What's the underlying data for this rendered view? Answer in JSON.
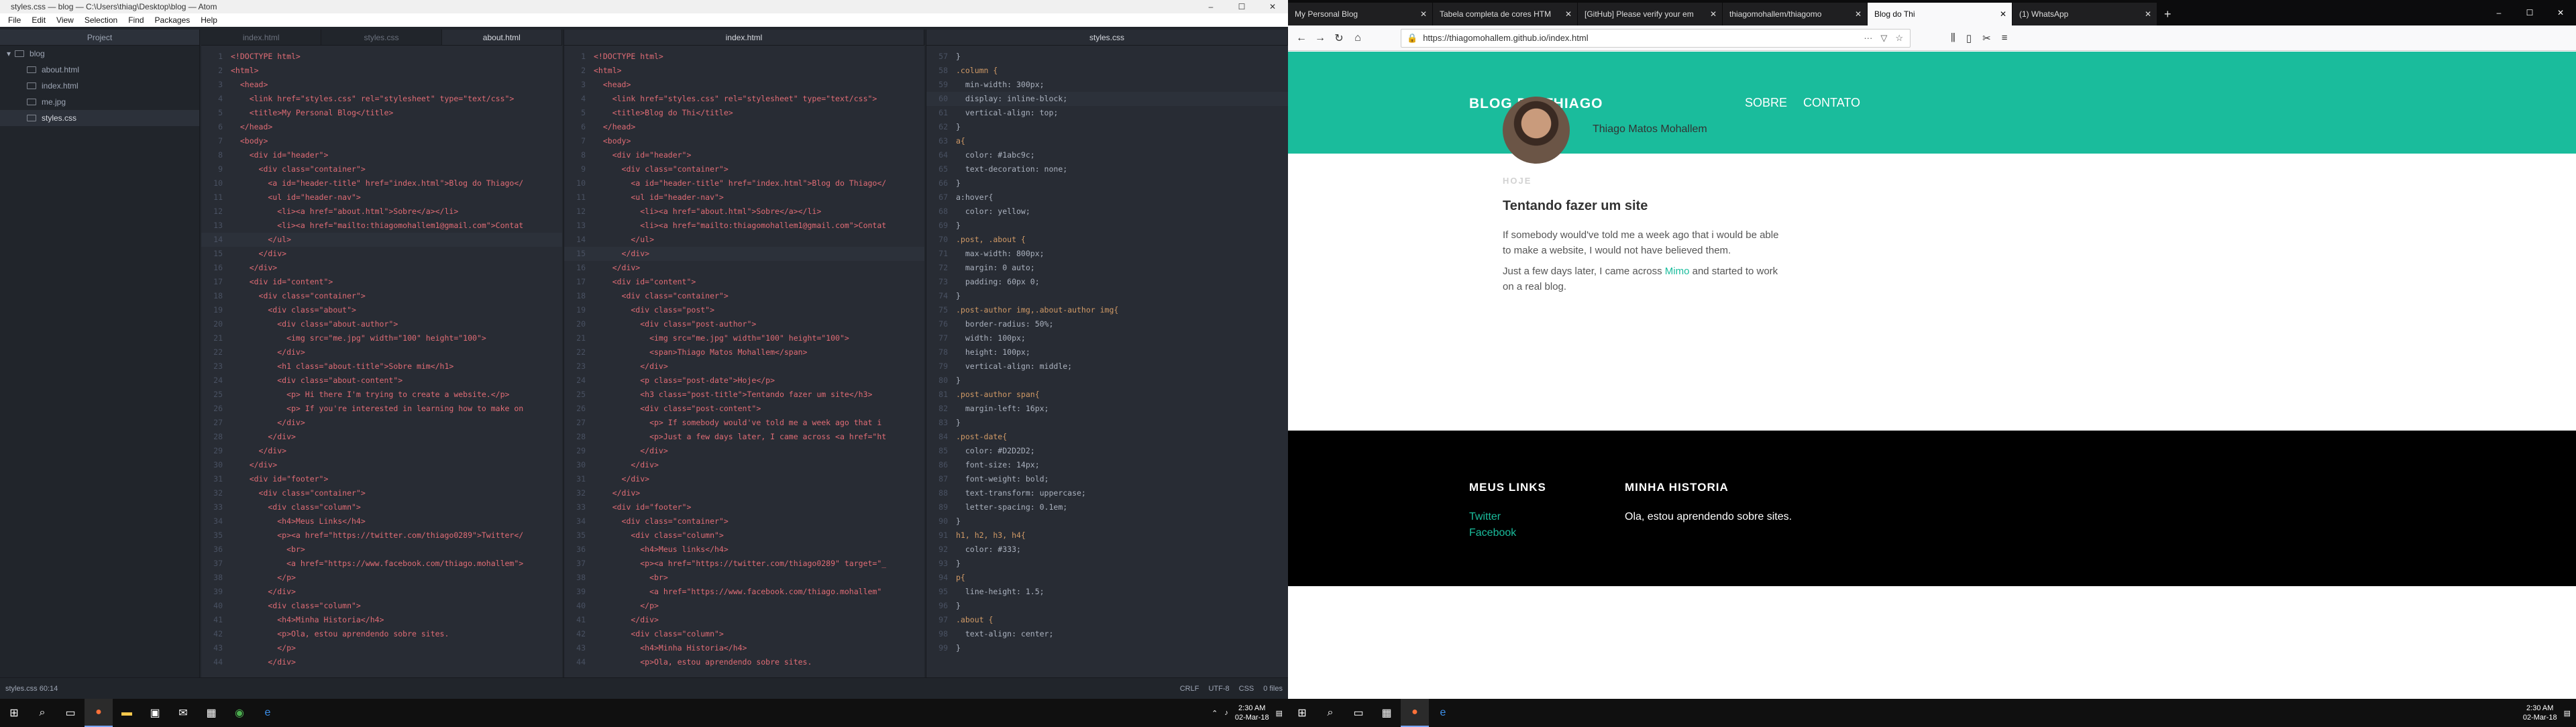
{
  "atom": {
    "window_title": "styles.css — blog — C:\\Users\\thiag\\Desktop\\blog — Atom",
    "menu": [
      "File",
      "Edit",
      "View",
      "Selection",
      "Find",
      "Packages",
      "Help"
    ],
    "project_header": "Project",
    "tree": [
      {
        "label": "blog",
        "type": "folder"
      },
      {
        "label": "about.html",
        "type": "file"
      },
      {
        "label": "index.html",
        "type": "file"
      },
      {
        "label": "me.jpg",
        "type": "file"
      },
      {
        "label": "styles.css",
        "type": "file",
        "selected": true
      }
    ],
    "pane1_tabs": [
      "index.html",
      "styles.css",
      "about.html"
    ],
    "pane2_tabs": [
      "index.html"
    ],
    "pane3_tabs": [
      "styles.css"
    ],
    "status_left": "styles.css   60:14",
    "status_right": [
      "CRLF",
      "UTF-8",
      "CSS",
      "0 files"
    ]
  },
  "code1": [
    "<!DOCTYPE html>",
    "<html>",
    "  <head>",
    "    <link href=\"styles.css\" rel=\"stylesheet\" type=\"text/css\">",
    "    <title>My Personal Blog</title>",
    "  </head>",
    "  <body>",
    "    <div id=\"header\">",
    "      <div class=\"container\">",
    "        <a id=\"header-title\" href=\"index.html\">Blog do Thiago</",
    "        <ul id=\"header-nav\">",
    "          <li><a href=\"about.html\">Sobre</a></li>",
    "          <li><a href=\"mailto:thiagomohallem1@gmail.com\">Contat",
    "        </ul>",
    "      </div>",
    "    </div>",
    "    <div id=\"content\">",
    "      <div class=\"container\">",
    "        <div class=\"about\">",
    "          <div class=\"about-author\">",
    "            <img src=\"me.jpg\" width=\"100\" height=\"100\">",
    "          </div>",
    "          <h1 class=\"about-title\">Sobre mim</h1>",
    "          <div class=\"about-content\">",
    "            <p> Hi there I'm trying to create a website.</p>",
    "            <p> If you're interested in learning how to make on",
    "          </div>",
    "        </div>",
    "      </div>",
    "    </div>",
    "    <div id=\"footer\">",
    "      <div class=\"container\">",
    "        <div class=\"column\">",
    "          <h4>Meus Links</h4>",
    "          <p><a href=\"https://twitter.com/thiago0289\">Twitter</",
    "            <br>",
    "            <a href=\"https://www.facebook.com/thiago.mohallem\">",
    "          </p>",
    "        </div>",
    "        <div class=\"column\">",
    "          <h4>Minha Historia</h4>",
    "          <p>Ola, estou aprendendo sobre sites.",
    "          </p>",
    "        </div>"
  ],
  "code2": [
    "<!DOCTYPE html>",
    "<html>",
    "  <head>",
    "    <link href=\"styles.css\" rel=\"stylesheet\" type=\"text/css\">",
    "    <title>Blog do Thi</title>",
    "  </head>",
    "  <body>",
    "    <div id=\"header\">",
    "      <div class=\"container\">",
    "        <a id=\"header-title\" href=\"index.html\">Blog do Thiago</",
    "        <ul id=\"header-nav\">",
    "          <li><a href=\"about.html\">Sobre</a></li>",
    "          <li><a href=\"mailto:thiagomohallem1@gmail.com\">Contat",
    "        </ul>",
    "      </div>",
    "    </div>",
    "    <div id=\"content\">",
    "      <div class=\"container\">",
    "        <div class=\"post\">",
    "          <div class=\"post-author\">",
    "            <img src=\"me.jpg\" width=\"100\" height=\"100\">",
    "            <span>Thiago Matos Mohallem</span>",
    "          </div>",
    "          <p class=\"post-date\">Hoje</p>",
    "          <h3 class=\"post-title\">Tentando fazer um site</h3>",
    "          <div class=\"post-content\">",
    "            <p> If somebody would've told me a week ago that i",
    "            <p>Just a few days later, I came across <a href=\"ht",
    "          </div>",
    "        </div>",
    "      </div>",
    "    </div>",
    "    <div id=\"footer\">",
    "      <div class=\"container\">",
    "        <div class=\"column\">",
    "          <h4>Meus links</h4>",
    "          <p><a href=\"https://twitter.com/thiago0289\" target=\"_",
    "            <br>",
    "            <a href=\"https://www.facebook.com/thiago.mohallem\"",
    "          </p>",
    "        </div>",
    "        <div class=\"column\">",
    "          <h4>Minha Historia</h4>",
    "          <p>Ola, estou aprendendo sobre sites."
  ],
  "code3": [
    "}",
    ".column {",
    "  min-width: 300px;",
    "  display: inline-block;",
    "  vertical-align: top;",
    "}",
    "a{",
    "  color: #1abc9c;",
    "  text-decoration: none;",
    "}",
    "a:hover{",
    "  color: yellow;",
    "}",
    ".post, .about {",
    "  max-width: 800px;",
    "  margin: 0 auto;",
    "  padding: 60px 0;",
    "}",
    ".post-author img,.about-author img{",
    "  border-radius: 50%;",
    "  width: 100px;",
    "  height: 100px;",
    "  vertical-align: middle;",
    "}",
    ".post-author span{",
    "  margin-left: 16px;",
    "}",
    ".post-date{",
    "  color: #D2D2D2;",
    "  font-size: 14px;",
    "  font-weight: bold;",
    "  text-transform: uppercase;",
    "  letter-spacing: 0.1em;",
    "}",
    "h1, h2, h3, h4{",
    "  color: #333;",
    "}",
    "p{",
    "  line-height: 1.5;",
    "}",
    ".about {",
    "  text-align: center;",
    "}"
  ],
  "code1_start": 1,
  "code2_start": 1,
  "code3_start": 57,
  "taskbar_left": {
    "time": "2:30 AM",
    "date": "02-Mar-18"
  },
  "firefox": {
    "tabs": [
      "My Personal Blog",
      "Tabela completa de cores HTM",
      "[GitHub] Please verify your em",
      "thiagomohallem/thiagomo",
      "Blog do Thi",
      "(1) WhatsApp"
    ],
    "url": "https://thiagomohallem.github.io/index.html"
  },
  "blog": {
    "title": "BLOG DO THIAGO",
    "nav": [
      "SOBRE",
      "CONTATO"
    ],
    "author": "Thiago Matos Mohallem",
    "date": "HOJE",
    "post_title": "Tentando fazer um site",
    "para1": "If somebody would've told me a week ago that i would be able to make a website, I would not have believed them.",
    "para2_before": "Just a few days later, I came across ",
    "para2_link": "Mimo",
    "para2_after": " and started to work on a real blog.",
    "footer_col1_title": "MEUS LINKS",
    "footer_links": [
      "Twitter",
      "Facebook"
    ],
    "footer_col2_title": "MINHA HISTORIA",
    "footer_col2_text": "Ola, estou aprendendo sobre sites."
  },
  "taskbar_right": {
    "time": "2:30 AM",
    "date": "02-Mar-18"
  }
}
